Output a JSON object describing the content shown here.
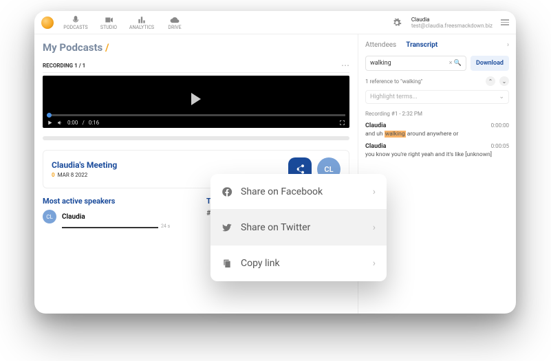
{
  "nav": {
    "podcasts": "PODCASTS",
    "studio": "STUDIO",
    "analytics": "ANALYTICS",
    "drive": "DRIVE"
  },
  "user": {
    "name": "Claudia",
    "email": "test@claudia.freesmackdown.biz"
  },
  "page": {
    "title": "My Podcasts",
    "slash": "/"
  },
  "recording": {
    "label": "RECORDING 1 / 1",
    "current": "0:00",
    "total": "0:16"
  },
  "meeting": {
    "title": "Claudia's Meeting",
    "zero": "0",
    "date": "MAR 8 2022",
    "initials": "CL"
  },
  "speakers": {
    "heading": "Most active speakers",
    "name": "Claudia",
    "initials": "CL",
    "duration": "24 s"
  },
  "topics": {
    "heading": "To",
    "tag": "#W"
  },
  "transcript": {
    "tabs": {
      "attendees": "Attendees",
      "transcript": "Transcript"
    },
    "search": "walking",
    "clear": "× ",
    "mag": "🔍",
    "download": "Download",
    "ref": "1 reference to \"walking\"",
    "highlight": "Highlight terms...",
    "recheader": "Recording #1 - 2:32 PM",
    "entries": [
      {
        "name": "Claudia",
        "ts": "0:00:00",
        "pre": "and uh ",
        "hl": "walking",
        "post": " around anywhere or"
      },
      {
        "name": "Claudia",
        "ts": "0:00:05",
        "text": "you know you're right yeah and it's like [unknown]"
      }
    ]
  },
  "share": {
    "fb": "Share on Facebook",
    "tw": "Share on Twitter",
    "copy": "Copy link"
  }
}
